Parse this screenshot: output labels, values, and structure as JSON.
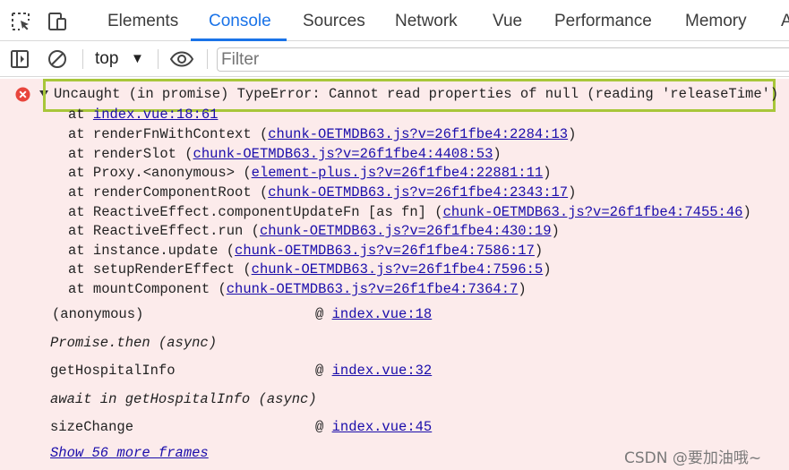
{
  "tabs": [
    {
      "label": "Elements",
      "active": false
    },
    {
      "label": "Console",
      "active": true
    },
    {
      "label": "Sources",
      "active": false
    },
    {
      "label": "Network",
      "active": false
    },
    {
      "label": "Vue",
      "active": false
    },
    {
      "label": "Performance",
      "active": false
    },
    {
      "label": "Memory",
      "active": false
    },
    {
      "label": "A",
      "active": false
    }
  ],
  "toolbar": {
    "context": "top",
    "filter_placeholder": "Filter"
  },
  "error": {
    "headline": "Uncaught (in promise) TypeError: Cannot read properties of null (reading 'releaseTime')",
    "stack": [
      {
        "prefix": "at ",
        "func": "",
        "open": "",
        "link": "index.vue:18:61",
        "close": ""
      },
      {
        "prefix": "at ",
        "func": "renderFnWithContext ",
        "open": "(",
        "link": "chunk-OETMDB63.js?v=26f1fbe4:2284:13",
        "close": ")"
      },
      {
        "prefix": "at ",
        "func": "renderSlot ",
        "open": "(",
        "link": "chunk-OETMDB63.js?v=26f1fbe4:4408:53",
        "close": ")"
      },
      {
        "prefix": "at ",
        "func": "Proxy.<anonymous> ",
        "open": "(",
        "link": "element-plus.js?v=26f1fbe4:22881:11",
        "close": ")"
      },
      {
        "prefix": "at ",
        "func": "renderComponentRoot ",
        "open": "(",
        "link": "chunk-OETMDB63.js?v=26f1fbe4:2343:17",
        "close": ")"
      },
      {
        "prefix": "at ",
        "func": "ReactiveEffect.componentUpdateFn [as fn] ",
        "open": "(",
        "link": "chunk-OETMDB63.js?v=26f1fbe4:7455:46",
        "close": ")"
      },
      {
        "prefix": "at ",
        "func": "ReactiveEffect.run ",
        "open": "(",
        "link": "chunk-OETMDB63.js?v=26f1fbe4:430:19",
        "close": ")"
      },
      {
        "prefix": "at ",
        "func": "instance.update ",
        "open": "(",
        "link": "chunk-OETMDB63.js?v=26f1fbe4:7586:17",
        "close": ")"
      },
      {
        "prefix": "at ",
        "func": "setupRenderEffect ",
        "open": "(",
        "link": "chunk-OETMDB63.js?v=26f1fbe4:7596:5",
        "close": ")"
      },
      {
        "prefix": "at ",
        "func": "mountComponent ",
        "open": "(",
        "link": "chunk-OETMDB63.js?v=26f1fbe4:7364:7",
        "close": ")"
      }
    ],
    "async_frames": [
      {
        "kind": "frame",
        "name": "(anonymous)",
        "at": "@ ",
        "link": "index.vue:18"
      },
      {
        "kind": "async",
        "label": "Promise.then (async)"
      },
      {
        "kind": "frame",
        "name": "getHospitalInfo",
        "at": "@ ",
        "link": "index.vue:32"
      },
      {
        "kind": "async",
        "label": "await in getHospitalInfo (async)"
      },
      {
        "kind": "frame",
        "name": "sizeChange",
        "at": "@ ",
        "link": "index.vue:45"
      }
    ],
    "more_frames": "Show 56 more frames"
  },
  "watermark": "CSDN @要加油哦~",
  "colors": {
    "accent": "#1a73e8",
    "error_bg": "#fcebeb",
    "error_icon": "#e8453c",
    "highlight": "#a8c63a",
    "link": "#1a0dab"
  }
}
